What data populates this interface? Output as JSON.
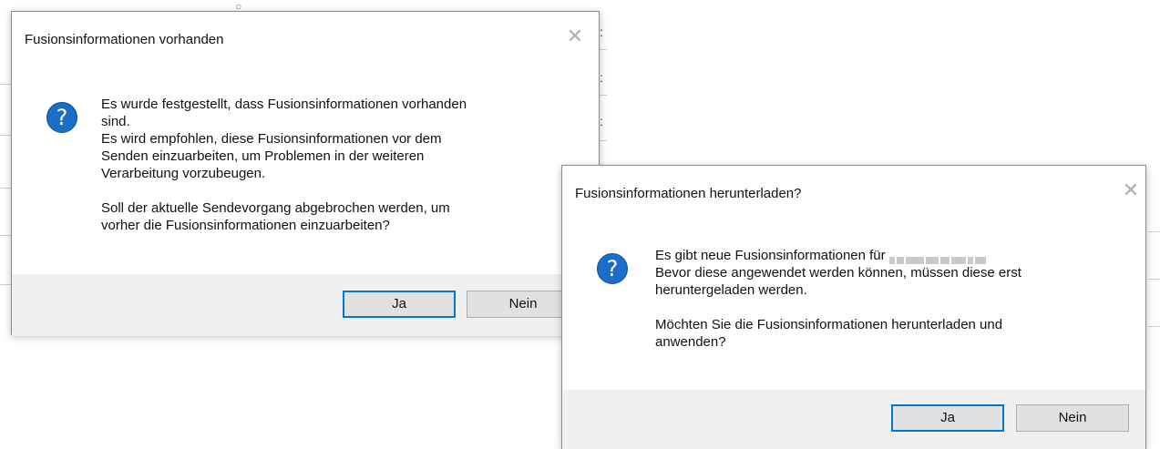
{
  "dialog_question": {
    "title": "Fusionsinformationen vorhanden",
    "message_lines": [
      "Es wurde festgestellt, dass Fusionsinformationen vorhanden",
      "sind.",
      "Es wird empfohlen, diese Fusionsinformationen vor dem",
      "Senden einzuarbeiten, um Problemen in der weiteren",
      "Verarbeitung vorzubeugen."
    ],
    "question_lines": [
      "Soll der aktuelle Sendevorgang abgebrochen werden, um",
      "vorher die Fusionsinformationen einzuarbeiten?"
    ],
    "yes_label": "Ja",
    "no_label": "Nein",
    "close_glyph": "✕"
  },
  "dialog_download": {
    "title": "Fusionsinformationen herunterladen?",
    "message_prefix": "Es gibt neue Fusionsinformationen für",
    "message_lines": [
      "Bevor diese angewendet werden können, müssen diese erst",
      "heruntergeladen werden."
    ],
    "question_lines": [
      "Möchten Sie die Fusionsinformationen herunterladen und",
      "anwenden?"
    ],
    "yes_label": "Ja",
    "no_label": "Nein",
    "close_glyph": "✕"
  },
  "icon_glyph": "?",
  "colors": {
    "question_icon": "#1a6ec7",
    "default_button_border": "#0078d7",
    "footer_background": "#f0f0f0",
    "button_background": "#e1e1e1"
  }
}
